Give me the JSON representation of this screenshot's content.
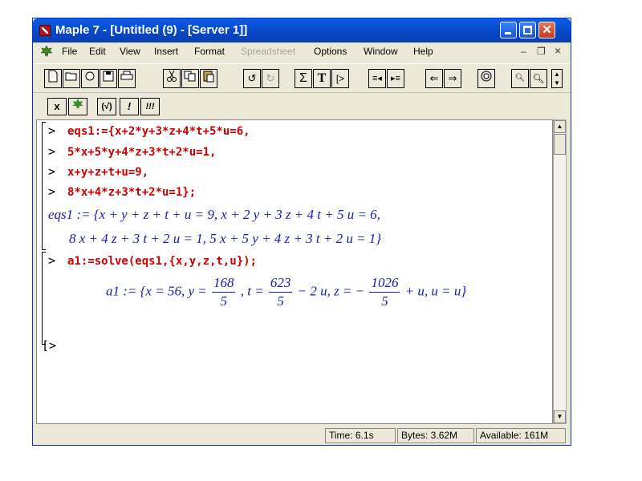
{
  "window": {
    "title": "Maple 7  - [Untitled (9) - [Server 1]]"
  },
  "menubar": {
    "items": [
      {
        "label": "File",
        "enabled": true
      },
      {
        "label": "Edit",
        "enabled": true
      },
      {
        "label": "View",
        "enabled": true
      },
      {
        "label": "Insert",
        "enabled": true
      },
      {
        "label": "Format",
        "enabled": true
      },
      {
        "label": "Spreadsheet",
        "enabled": false
      },
      {
        "label": "Options",
        "enabled": true
      },
      {
        "label": "Window",
        "enabled": true
      },
      {
        "label": "Help",
        "enabled": true
      }
    ],
    "mdi_minimize": "–",
    "mdi_restore": "❐",
    "mdi_close": "×"
  },
  "toolbar2": {
    "x_label": "x",
    "check_label": "(√)",
    "bang_label": "!",
    "triple_bang_label": "!!!"
  },
  "toolbar1": {
    "sum_label": "Σ",
    "text_label": "T",
    "prompt_label": "[>"
  },
  "worksheet": {
    "group1": {
      "prompt": ">",
      "lines": [
        "eqs1:={x+2*y+3*z+4*t+5*u=6,",
        "5*x+5*y+4*z+3*t+2*u=1,",
        "x+y+z+t+u=9,",
        "8*x+4*z+3*t+2*u=1};"
      ],
      "output_line1": "eqs1 := {x + y + z + t + u = 9, x + 2 y + 3 z + 4 t + 5 u = 6,",
      "output_line2": "8 x + 4 z + 3 t + 2 u = 1, 5 x + 5 y + 4 z + 3 t + 2 u = 1}"
    },
    "group2": {
      "prompt": ">",
      "command": "a1:=solve(eqs1,{x,y,z,t,u});",
      "output": {
        "lhs": "a1 := {x = 56, y =",
        "frac1_num": "168",
        "frac1_den": "5",
        "mid1": ", t =",
        "frac2_num": "623",
        "frac2_den": "5",
        "mid2": "− 2 u, z = −",
        "frac3_num": "1026",
        "frac3_den": "5",
        "tail": "+ u, u = u}"
      }
    },
    "group3": {
      "prompt": "[>"
    }
  },
  "statusbar": {
    "time": "Time:  6.1s",
    "bytes": "Bytes: 3.62M",
    "available": "Available: 161M"
  },
  "colors": {
    "input": "#cc0000",
    "output": "#1a1ab0",
    "titlebar": "#0747c4"
  }
}
